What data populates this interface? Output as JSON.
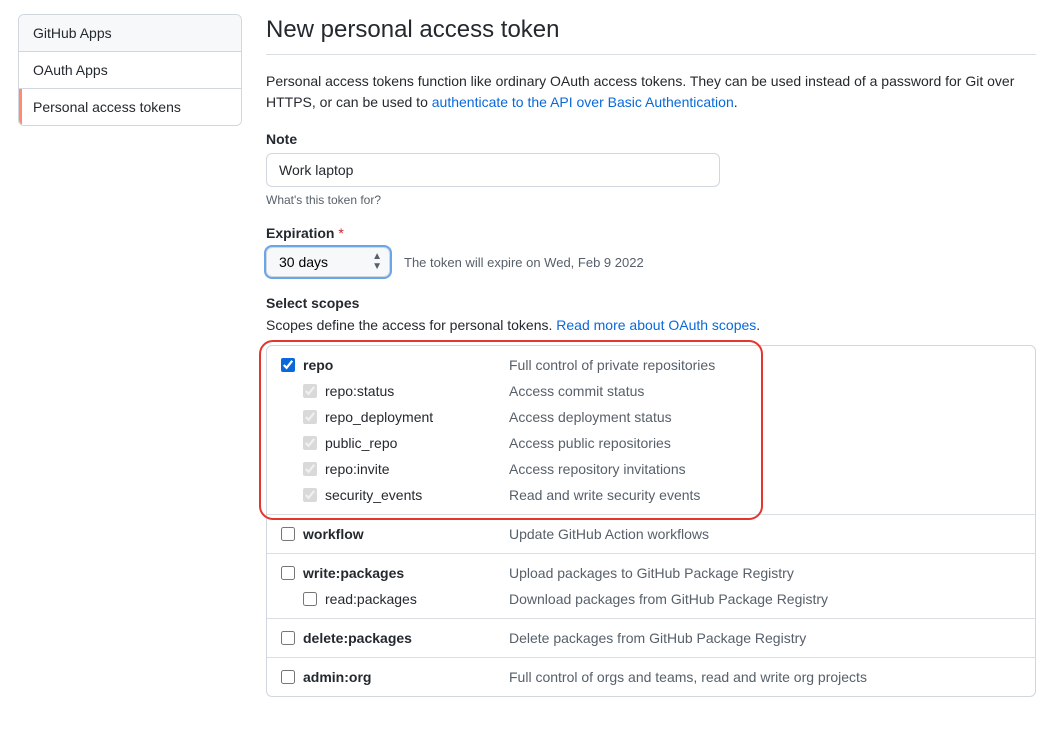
{
  "sidenav": {
    "items": [
      {
        "label": "GitHub Apps",
        "active": false,
        "hover": true
      },
      {
        "label": "OAuth Apps",
        "active": false,
        "hover": false
      },
      {
        "label": "Personal access tokens",
        "active": true,
        "hover": false
      }
    ]
  },
  "page": {
    "title": "New personal access token",
    "lead_pre": "Personal access tokens function like ordinary OAuth access tokens. They can be used instead of a password for Git over HTTPS, or can be used to ",
    "lead_link": "authenticate to the API over Basic Authentication",
    "lead_post": "."
  },
  "note": {
    "label": "Note",
    "value": "Work laptop",
    "hint": "What's this token for?"
  },
  "expiration": {
    "label": "Expiration",
    "value": "30 days",
    "message": "The token will expire on Wed, Feb 9 2022"
  },
  "scopes": {
    "heading": "Select scopes",
    "intro_pre": "Scopes define the access for personal tokens. ",
    "intro_link": "Read more about OAuth scopes",
    "intro_post": ".",
    "groups": [
      {
        "name": "repo",
        "desc": "Full control of private repositories",
        "checked": true,
        "disabled": false,
        "strong": true,
        "highlight": true,
        "children": [
          {
            "name": "repo:status",
            "desc": "Access commit status",
            "checked": true,
            "disabled": true
          },
          {
            "name": "repo_deployment",
            "desc": "Access deployment status",
            "checked": true,
            "disabled": true
          },
          {
            "name": "public_repo",
            "desc": "Access public repositories",
            "checked": true,
            "disabled": true
          },
          {
            "name": "repo:invite",
            "desc": "Access repository invitations",
            "checked": true,
            "disabled": true
          },
          {
            "name": "security_events",
            "desc": "Read and write security events",
            "checked": true,
            "disabled": true
          }
        ]
      },
      {
        "name": "workflow",
        "desc": "Update GitHub Action workflows",
        "checked": false,
        "disabled": false,
        "strong": true,
        "children": []
      },
      {
        "name": "write:packages",
        "desc": "Upload packages to GitHub Package Registry",
        "checked": false,
        "disabled": false,
        "strong": true,
        "children": [
          {
            "name": "read:packages",
            "desc": "Download packages from GitHub Package Registry",
            "checked": false,
            "disabled": false
          }
        ]
      },
      {
        "name": "delete:packages",
        "desc": "Delete packages from GitHub Package Registry",
        "checked": false,
        "disabled": false,
        "strong": true,
        "children": []
      },
      {
        "name": "admin:org",
        "desc": "Full control of orgs and teams, read and write org projects",
        "checked": false,
        "disabled": false,
        "strong": true,
        "children": []
      }
    ]
  }
}
